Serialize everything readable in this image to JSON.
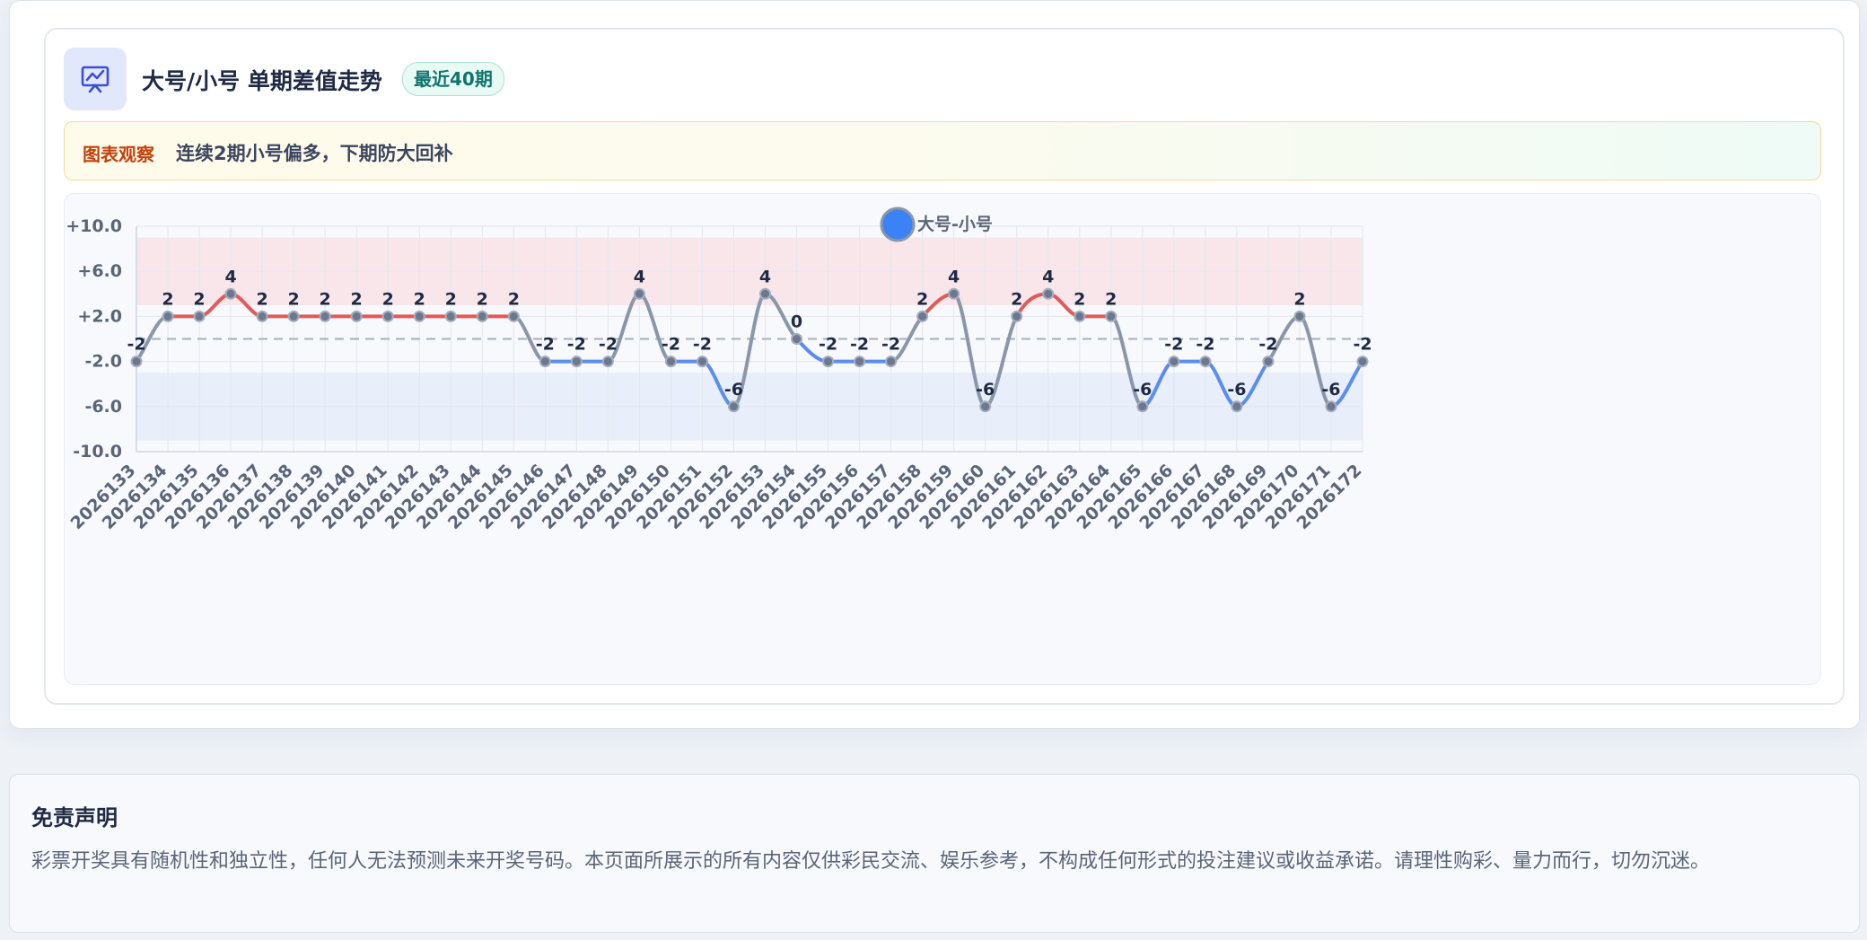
{
  "header": {
    "title": "大号/小号 单期差值走势",
    "badge": "最近40期",
    "icon": "presentation-chart-icon"
  },
  "insight": {
    "tag": "图表观察",
    "text": "连续2期小号偏多，下期防大回补"
  },
  "disclaimer": {
    "title": "免责声明",
    "body": "彩票开奖具有随机性和独立性，任何人无法预测未来开奖号码。本页面所展示的所有内容仅供彩民交流、娱乐参考，不构成任何形式的投注建议或收益承诺。请理性购彩、量力而行，切勿沉迷。"
  },
  "colors": {
    "positive": "#e05a5a",
    "negative": "#5b8def",
    "neutral": "#8a97aa",
    "legend_marker": "#3b82f6",
    "upper_band": "#f8e6ea",
    "lower_band": "#e8eefa"
  },
  "chart_data": {
    "type": "line",
    "legend": "大号-小号",
    "legend_position": "top-center",
    "ylim": [
      -10,
      10
    ],
    "yticks": [
      "+10.0",
      "+6.0",
      "+2.0",
      "-2.0",
      "-6.0",
      "-10.0"
    ],
    "ytick_values": [
      10,
      6,
      2,
      -2,
      -6,
      -10
    ],
    "grid": true,
    "reference_line": 0,
    "bands": [
      {
        "from": 3,
        "to": 9
      },
      {
        "from": -9,
        "to": -3
      }
    ],
    "categories": [
      "2026133",
      "2026134",
      "2026135",
      "2026136",
      "2026137",
      "2026138",
      "2026139",
      "2026140",
      "2026141",
      "2026142",
      "2026143",
      "2026144",
      "2026145",
      "2026146",
      "2026147",
      "2026148",
      "2026149",
      "2026150",
      "2026151",
      "2026152",
      "2026153",
      "2026154",
      "2026155",
      "2026156",
      "2026157",
      "2026158",
      "2026159",
      "2026160",
      "2026161",
      "2026162",
      "2026163",
      "2026164",
      "2026165",
      "2026166",
      "2026167",
      "2026168",
      "2026169",
      "2026170",
      "2026171",
      "2026172"
    ],
    "values": [
      -2,
      2,
      2,
      4,
      2,
      2,
      2,
      2,
      2,
      2,
      2,
      2,
      2,
      -2,
      -2,
      -2,
      4,
      -2,
      -2,
      -6,
      4,
      0,
      -2,
      -2,
      -2,
      2,
      4,
      -6,
      2,
      4,
      2,
      2,
      -6,
      -2,
      -2,
      -6,
      -2,
      2,
      -6,
      -2
    ]
  }
}
